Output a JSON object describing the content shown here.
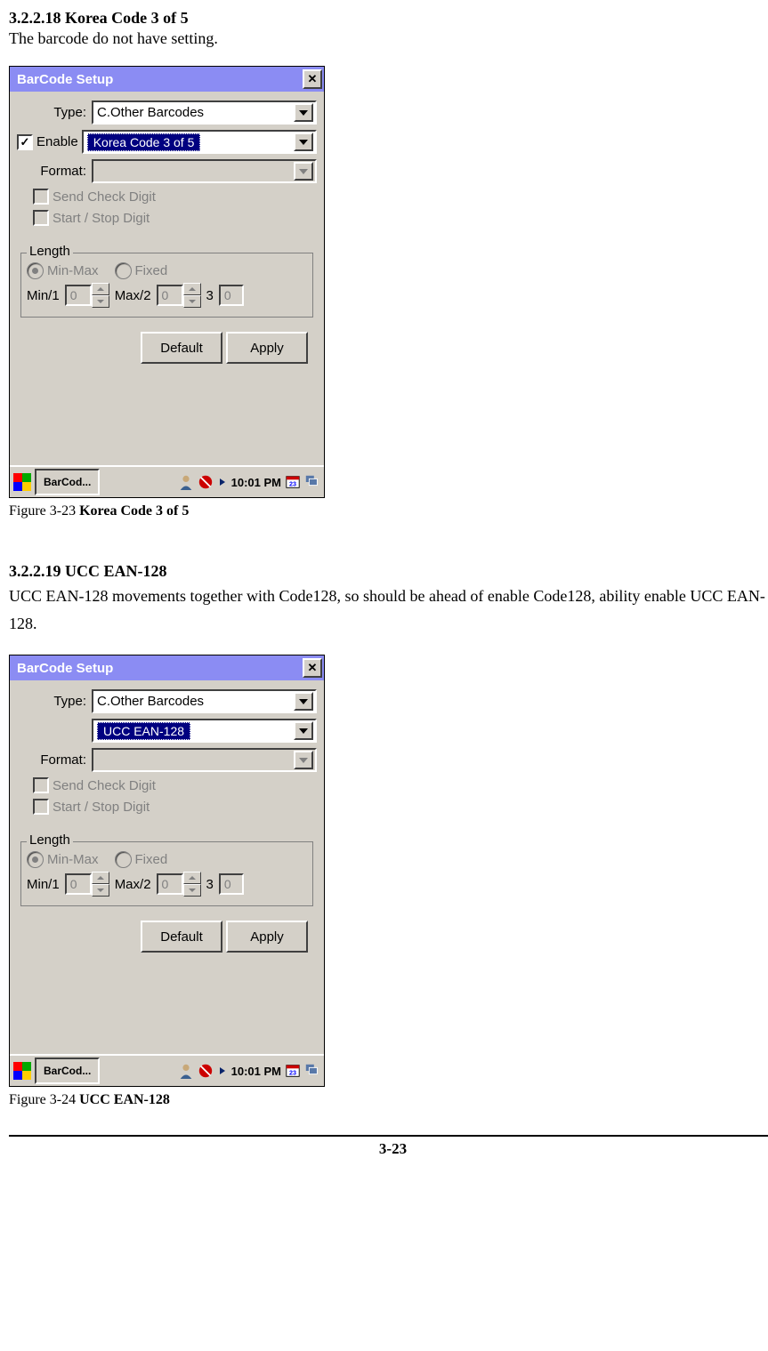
{
  "sections": {
    "a": {
      "heading": "3.2.2.18 Korea Code 3 of 5",
      "text": "The barcode do not have setting.",
      "caption_prefix": "Figure 3-23 ",
      "caption_bold": "Korea Code 3 of 5"
    },
    "b": {
      "heading": "3.2.2.19 UCC EAN-128",
      "text": "UCC EAN-128 movements together with Code128, so should be ahead of enable Code128, ability enable UCC EAN-128.",
      "caption_prefix": "Figure 3-24 ",
      "caption_bold": "UCC EAN-128"
    }
  },
  "dialog": {
    "title": "BarCode Setup",
    "type_label": "Type:",
    "type_value": "C.Other Barcodes",
    "enable_label": "Enable",
    "format_label": "Format:",
    "send_check": "Send Check Digit",
    "start_stop": "Start / Stop Digit",
    "length_label": "Length",
    "minmax": "Min-Max",
    "fixed": "Fixed",
    "min_label": "Min/1",
    "min_value": "0",
    "max_label": "Max/2",
    "max_value": "0",
    "three_label": "3",
    "three_value": "0",
    "default_btn": "Default",
    "apply_btn": "Apply",
    "taskbar_app": "BarCod...",
    "clock": "10:01 PM"
  },
  "dialog_a": {
    "barcode_name": "Korea Code 3 of 5",
    "enable_checked": true
  },
  "dialog_b": {
    "barcode_name": "UCC EAN-128",
    "enable_checked": false
  },
  "page_number": "3-23"
}
